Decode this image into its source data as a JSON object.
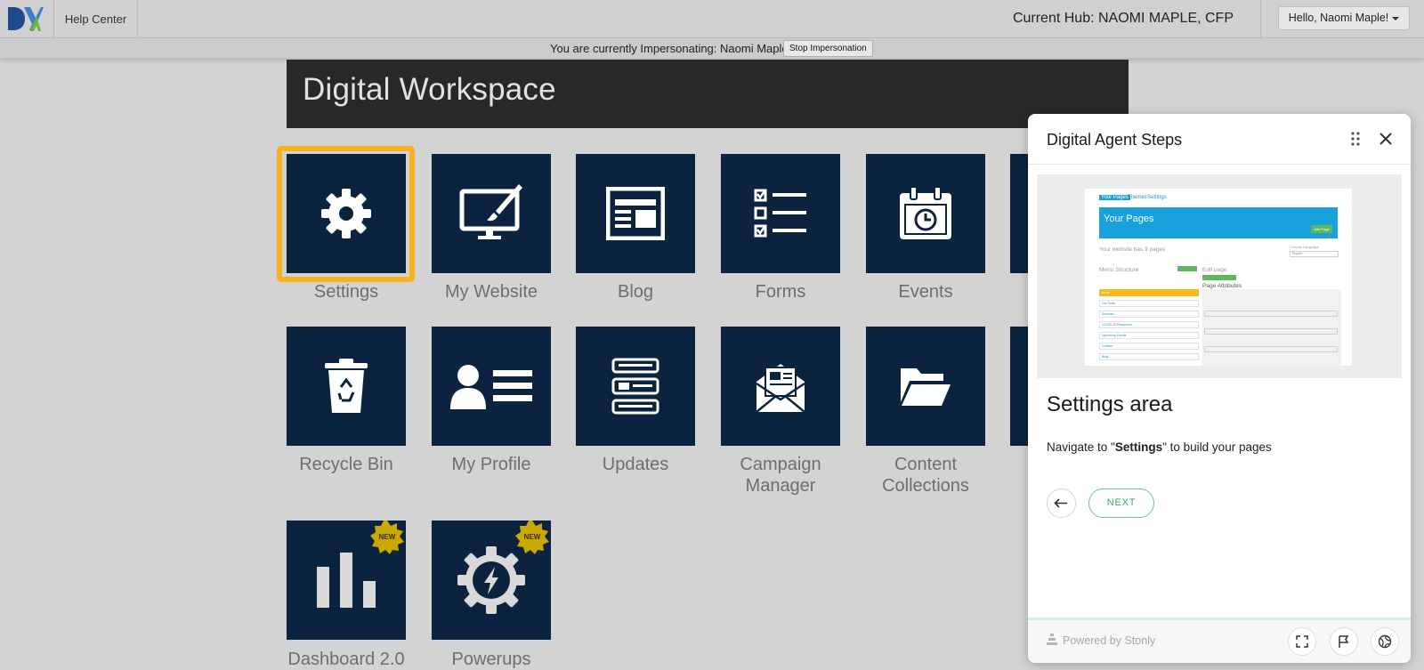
{
  "topbar": {
    "help_center": "Help Center",
    "current_hub": "Current Hub: NAOMI MAPLE, CFP",
    "greeting": "Hello, Naomi Maple!"
  },
  "impersonation": {
    "message": "You are currently Impersonating: Naomi Maple",
    "stop_label": "Stop Impersonation"
  },
  "workspace": {
    "title": "Digital Workspace",
    "tiles": [
      {
        "label": "Settings",
        "icon": "gear-icon"
      },
      {
        "label": "My Website",
        "icon": "monitor-brush-icon"
      },
      {
        "label": "Blog",
        "icon": "newspaper-icon"
      },
      {
        "label": "Forms",
        "icon": "checklist-icon"
      },
      {
        "label": "Events",
        "icon": "calendar-clock-icon"
      },
      {
        "label": "Recycle Bin",
        "icon": "recycle-bin-icon"
      },
      {
        "label": "My Profile",
        "icon": "profile-card-icon"
      },
      {
        "label": "Updates",
        "icon": "list-stack-icon"
      },
      {
        "label": "Campaign Manager",
        "icon": "envelope-icon"
      },
      {
        "label": "Content Collections",
        "icon": "folder-open-icon"
      },
      {
        "label": "Dashboard 2.0",
        "icon": "bar-chart-icon",
        "badge": "NEW"
      },
      {
        "label": "Powerups",
        "icon": "gear-bolt-icon",
        "badge": "NEW"
      }
    ]
  },
  "guide": {
    "title": "Digital Agent Steps",
    "step_title": "Settings area",
    "desc_before": "Navigate to \"",
    "desc_bold": "Settings",
    "desc_after": "\" to build your pages",
    "next_label": "NEXT",
    "powered_by": "Powered by Stonly",
    "preview": {
      "tab_pages": "Your Pages",
      "tab_themes": "Themes",
      "tab_settings": "Settings",
      "banner": "Your Pages",
      "add_page": "Add Page",
      "count_text": "Your website has 9 pages",
      "language_label": "Choose Language",
      "language_value": "English",
      "menu_structure": "Menu Structure",
      "edit_page": "Edit page",
      "page_attributes": "Page Attributes",
      "menu_items": [
        "Home",
        "Our Team",
        "Services",
        "COVID-19 Resources",
        "Upcoming Events",
        "Contact",
        "Blog"
      ]
    }
  },
  "colors": {
    "tile": "#0c2340",
    "highlight": "#f9b11f",
    "next": "#3aa866"
  }
}
